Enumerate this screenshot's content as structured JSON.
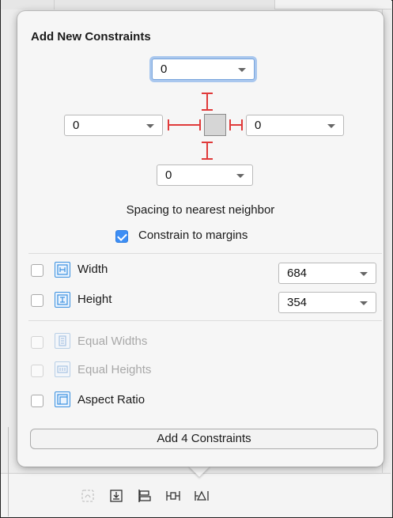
{
  "popover": {
    "title": "Add New Constraints",
    "spacing": {
      "top": "0",
      "left": "0",
      "right": "0",
      "bottom": "0",
      "caption": "Spacing to nearest neighbor"
    },
    "constrain_margins": {
      "label": "Constrain to margins",
      "checked": true
    },
    "rows": [
      {
        "label": "Width",
        "value": "684",
        "checked": false,
        "enabled": true,
        "icon": "width-icon"
      },
      {
        "label": "Height",
        "value": "354",
        "checked": false,
        "enabled": true,
        "icon": "height-icon"
      },
      {
        "label": "Equal Widths",
        "checked": false,
        "enabled": false,
        "icon": "equal-widths-icon"
      },
      {
        "label": "Equal Heights",
        "checked": false,
        "enabled": false,
        "icon": "equal-heights-icon"
      },
      {
        "label": "Aspect Ratio",
        "checked": false,
        "enabled": true,
        "icon": "aspect-ratio-icon"
      }
    ],
    "add_button": "Add 4 Constraints"
  },
  "colors": {
    "strut_red": "#e03a3a",
    "accent_blue": "#3d8ef5"
  },
  "toolbar": {
    "icons": [
      "update-frames-icon",
      "embed-in-stack-icon",
      "align-icon",
      "pin-icon",
      "resolve-issues-icon"
    ]
  }
}
